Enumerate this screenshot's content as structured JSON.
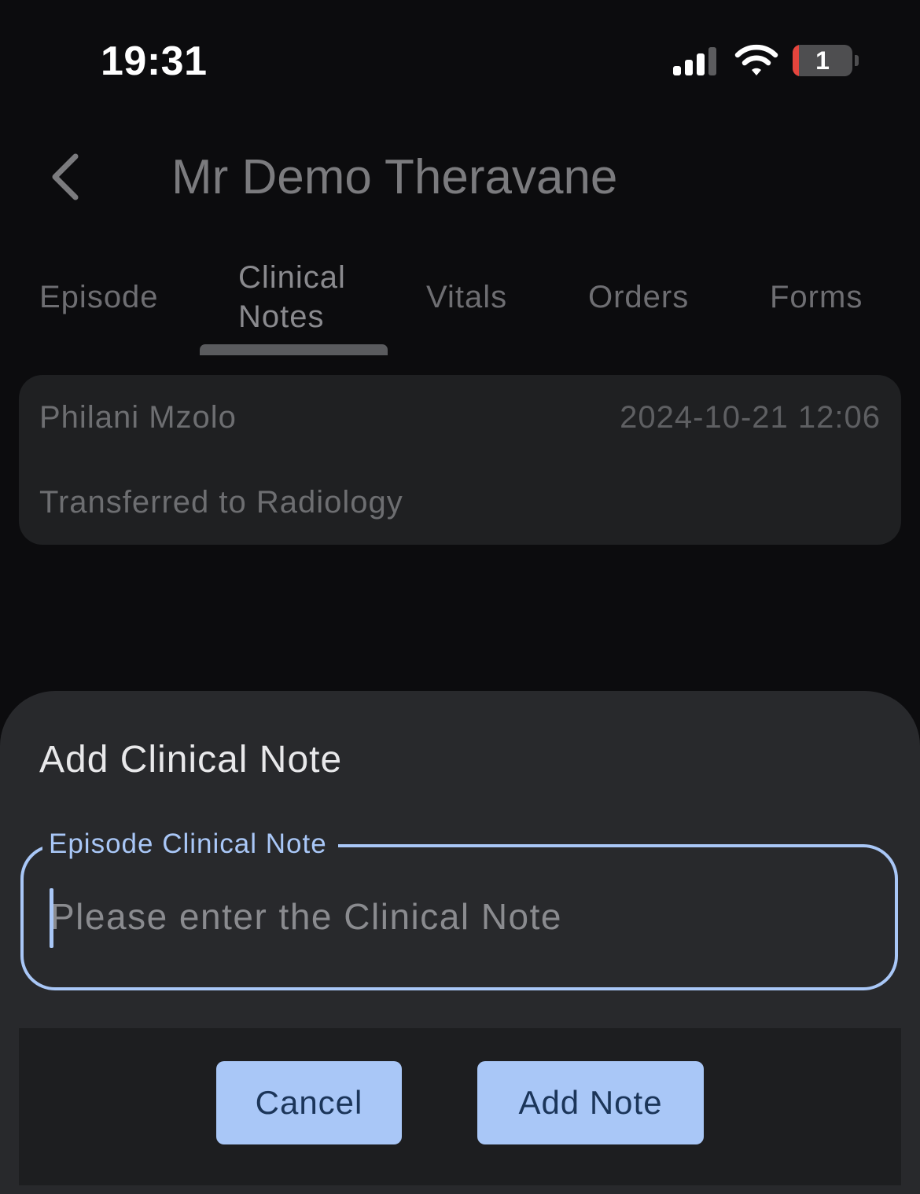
{
  "status_bar": {
    "time": "19:31",
    "battery_level": "1",
    "icons": [
      "signal-icon",
      "wifi-icon",
      "battery-icon"
    ]
  },
  "header": {
    "back_icon": "chevron-left-icon",
    "title": "Mr Demo Theravane"
  },
  "tabs": {
    "episode": "Episode",
    "clinical_notes_line1": "Clinical",
    "clinical_notes_line2": "Notes",
    "vitals": "Vitals",
    "orders": "Orders",
    "forms": "Forms",
    "active": "Clinical Notes"
  },
  "note": {
    "author": "Philani Mzolo",
    "datetime": "2024-10-21 12:06",
    "text": "Transferred to Radiology"
  },
  "sheet": {
    "title": "Add Clinical Note",
    "field_label": "Episode Clinical Note",
    "field_placeholder": "Please enter the Clinical Note",
    "field_value": "",
    "cancel_label": "Cancel",
    "add_label": "Add Note"
  },
  "colors": {
    "accent": "#a9c7f7",
    "button_text": "#1b3559",
    "background": "#0c0c0e",
    "sheet": "#28292c",
    "battery_low": "#e5453d"
  }
}
